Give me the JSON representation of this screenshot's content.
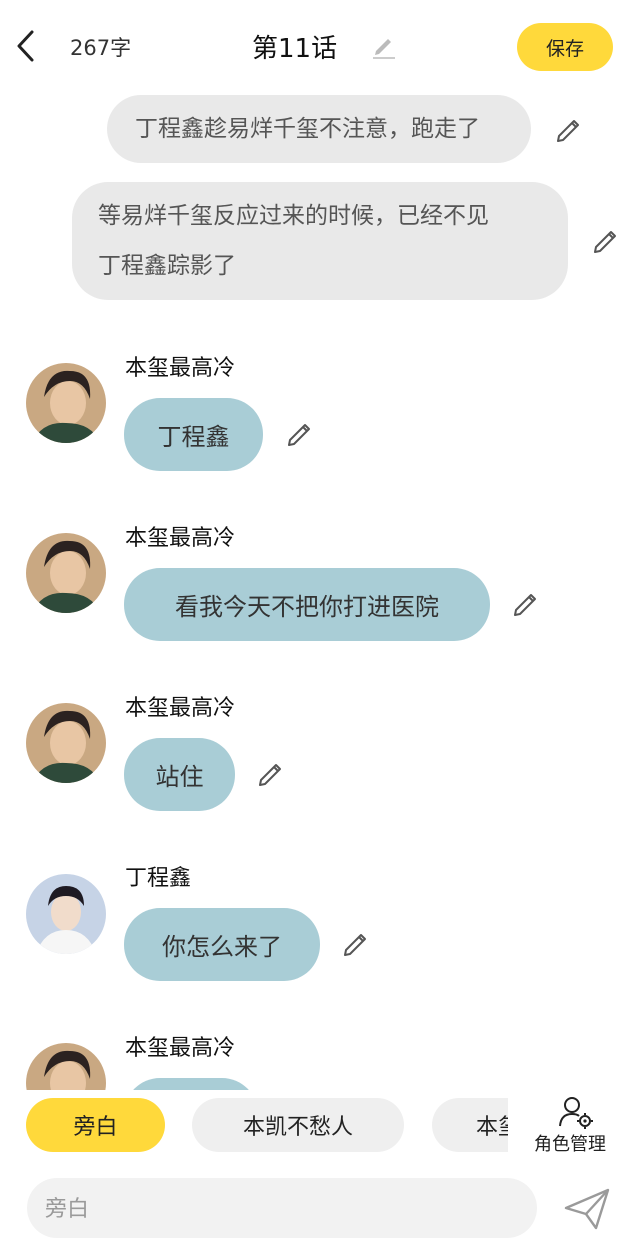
{
  "header": {
    "word_count": "267字",
    "title": "第11话",
    "save_label": "保存"
  },
  "narrations": [
    {
      "text": "丁程鑫趁易烊千玺不注意，跑走了"
    },
    {
      "line1": "等易烊千玺反应过来的时候，已经不见",
      "line2": "丁程鑫踪影了"
    }
  ],
  "messages": [
    {
      "speaker": "本玺最高冷",
      "text": "丁程鑫"
    },
    {
      "speaker": "本玺最高冷",
      "text": "看我今天不把你打进医院"
    },
    {
      "speaker": "本玺最高冷",
      "text": "站住"
    },
    {
      "speaker": "丁程鑫",
      "text": "你怎么来了"
    },
    {
      "speaker": "本玺最高冷",
      "text": ""
    }
  ],
  "roles": {
    "items": [
      {
        "label": "旁白",
        "active": true
      },
      {
        "label": "本凯不愁人",
        "active": false
      },
      {
        "label": "本玺",
        "active": false
      }
    ],
    "manage_label": "角色管理"
  },
  "input": {
    "placeholder": "旁白",
    "value": ""
  },
  "colors": {
    "accent": "#FFD93B",
    "narration_bubble": "#E9E9E9",
    "character_bubble": "#A9CDD6",
    "chip": "#EFEFEF"
  },
  "icons": {
    "back": "chevron-left-icon",
    "edit": "pencil-icon",
    "role_manage": "user-gear-icon",
    "send": "paper-plane-icon"
  }
}
